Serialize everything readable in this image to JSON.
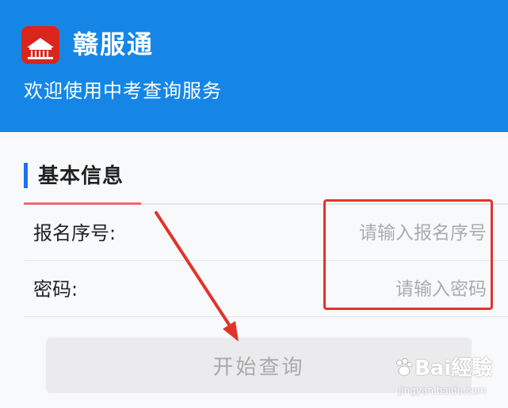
{
  "header": {
    "app_name": "赣服通",
    "welcome": "欢迎使用中考查询服务",
    "logo_icon": "gate-building-logo-icon",
    "colors": {
      "header_bg": "#1686e6",
      "logo_bg": "#d8261d"
    }
  },
  "section": {
    "title": "基本信息",
    "accent": "#1a73e8"
  },
  "form": {
    "fields": [
      {
        "label": "报名序号:",
        "placeholder": "请输入报名序号",
        "value": ""
      },
      {
        "label": "密码:",
        "placeholder": "请输入密码",
        "value": ""
      }
    ]
  },
  "button": {
    "label": "开始查询",
    "state": "disabled"
  },
  "annotation": {
    "color": "#e1332e",
    "type": "red-box-and-arrow"
  },
  "watermark": {
    "brand": "Bai經驗",
    "url": "jingyan.baidu.com",
    "icon": "baidu-paw-icon"
  }
}
